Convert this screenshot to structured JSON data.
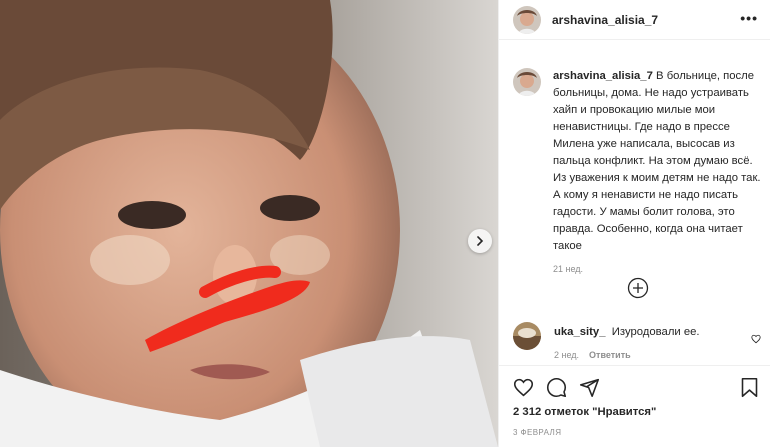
{
  "post": {
    "username": "arshavina_alisia_7",
    "more_label": "•••",
    "caption_text": "В больнице, после больницы, дома. Не надо устраивать хайп и провокацию милые мои ненавистницы. Где надо в прессе Милена уже написала, высосав из пальца конфликт. На этом думаю всё. Из уважения к моим детям не надо так. А кому я ненависти не надо писать гадости. У мамы болит голова, это правда. Особенно, когда она читает такое",
    "caption_time": "21 нед.",
    "likes": "2 312 отметок \"Нравится\"",
    "date": "3 ФЕВРАЛЯ"
  },
  "comment": {
    "username": "uka_sity_",
    "text": "Изуродовали ее.",
    "time": "2 нед.",
    "reply_label": "Ответить"
  },
  "icons": {
    "like": "heart-icon",
    "comment": "comment-icon",
    "share": "share-icon",
    "save": "bookmark-icon",
    "more_comments": "plus-circle-icon",
    "next": "chevron-right-icon"
  },
  "colors": {
    "text": "#262626",
    "muted": "#8e8e8e",
    "border": "#efefef",
    "redaction": "#f02b1d"
  }
}
